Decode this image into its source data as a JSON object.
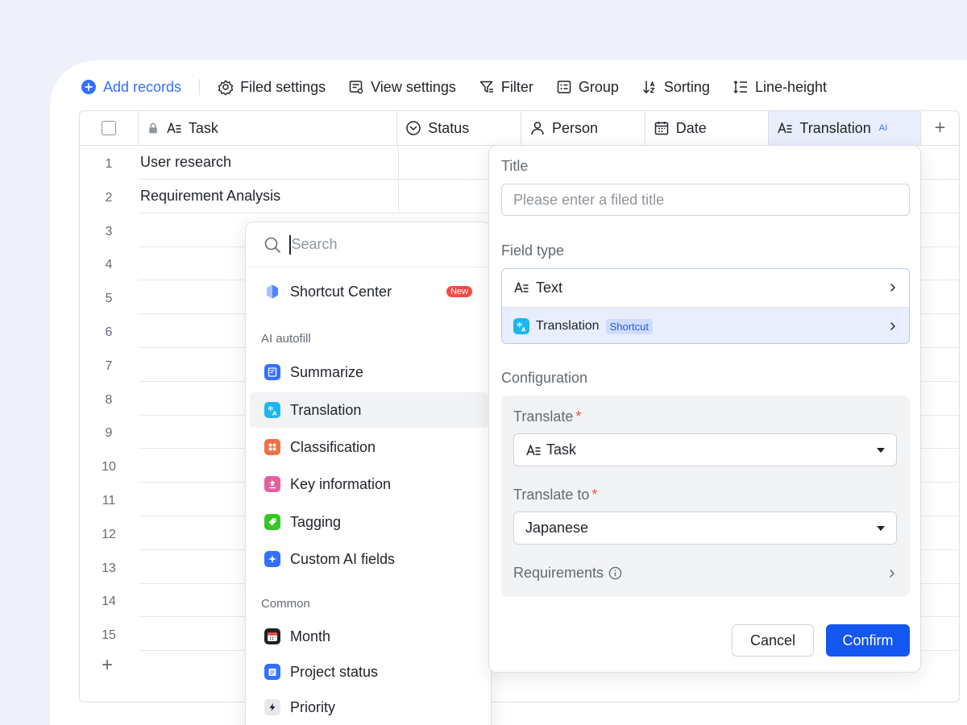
{
  "toolbar": {
    "add_records": "Add records",
    "filed_settings": "Filed settings",
    "view_settings": "View settings",
    "filter": "Filter",
    "group": "Group",
    "sorting": "Sorting",
    "line_height": "Line-height"
  },
  "table": {
    "columns": {
      "task": "Task",
      "status": "Status",
      "person": "Person",
      "date": "Date",
      "translation": "Translation",
      "translation_badge": "AI"
    },
    "row_numbers": [
      "1",
      "2",
      "3",
      "4",
      "5",
      "6",
      "7",
      "8",
      "9",
      "10",
      "11",
      "12",
      "13",
      "14",
      "15"
    ],
    "tasks": [
      "User research",
      "Requirement Analysis"
    ],
    "add_row": "+",
    "add_column": "+"
  },
  "dropdown": {
    "search_placeholder": "Search",
    "shortcut_center": "Shortcut Center",
    "new_badge": "New",
    "ai_section": "AI autofill",
    "ai_items": [
      "Summarize",
      "Translation",
      "Classification",
      "Key information",
      "Tagging",
      "Custom AI fields"
    ],
    "common_section": "Common",
    "common_items": [
      "Month",
      "Project status",
      "Priority"
    ]
  },
  "panel": {
    "title_label": "Title",
    "title_placeholder": "Please enter a filed title",
    "field_type_label": "Field type",
    "type_text": "Text",
    "type_translation": "Translation",
    "shortcut_badge": "Shortcut",
    "configuration_label": "Configuration",
    "translate_label": "Translate",
    "translate_value": "Task",
    "translate_to_label": "Translate to",
    "translate_to_value": "Japanese",
    "required_mark": "*",
    "requirements_label": "Requirements",
    "cancel": "Cancel",
    "confirm": "Confirm"
  },
  "colors": {
    "accent": "#3370ff",
    "confirm": "#1456f0",
    "background": "#eef0fa",
    "new_badge": "#f54a45"
  }
}
